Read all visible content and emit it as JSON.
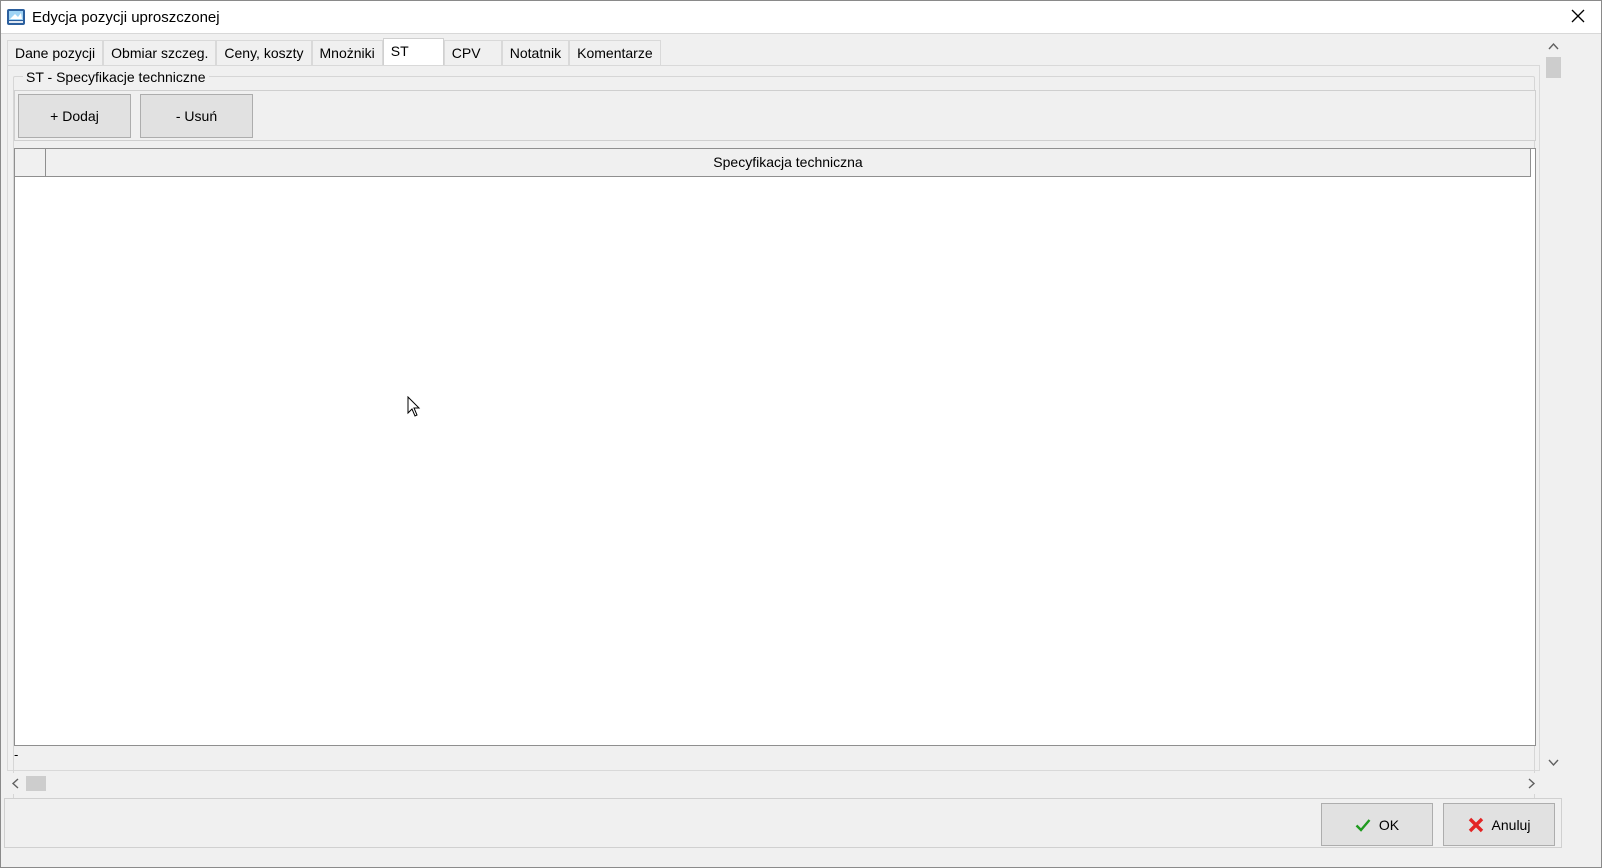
{
  "window": {
    "title": "Edycja pozycji uproszczonej",
    "app_icon": "app-logo-icon",
    "close_icon": "close-icon"
  },
  "tabs": [
    {
      "label": "Dane pozycji",
      "active": false
    },
    {
      "label": "Obmiar szczeg.",
      "active": false
    },
    {
      "label": "Ceny, koszty",
      "active": false
    },
    {
      "label": "Mnożniki",
      "active": false
    },
    {
      "label": "ST",
      "active": true
    },
    {
      "label": "CPV",
      "active": false
    },
    {
      "label": "Notatnik",
      "active": false
    },
    {
      "label": "Komentarze",
      "active": false
    }
  ],
  "group": {
    "title": "ST - Specyfikacje techniczne",
    "add_label": "+ Dodaj",
    "delete_label": "- Usuń"
  },
  "grid": {
    "columns": [
      "Specyfikacja techniczna"
    ],
    "rows": []
  },
  "status": {
    "text": "-"
  },
  "footer": {
    "ok_label": "OK",
    "cancel_label": "Anuluj",
    "colors": {
      "ok_check": "#1f9b1f",
      "cancel_x": "#e32424"
    }
  }
}
